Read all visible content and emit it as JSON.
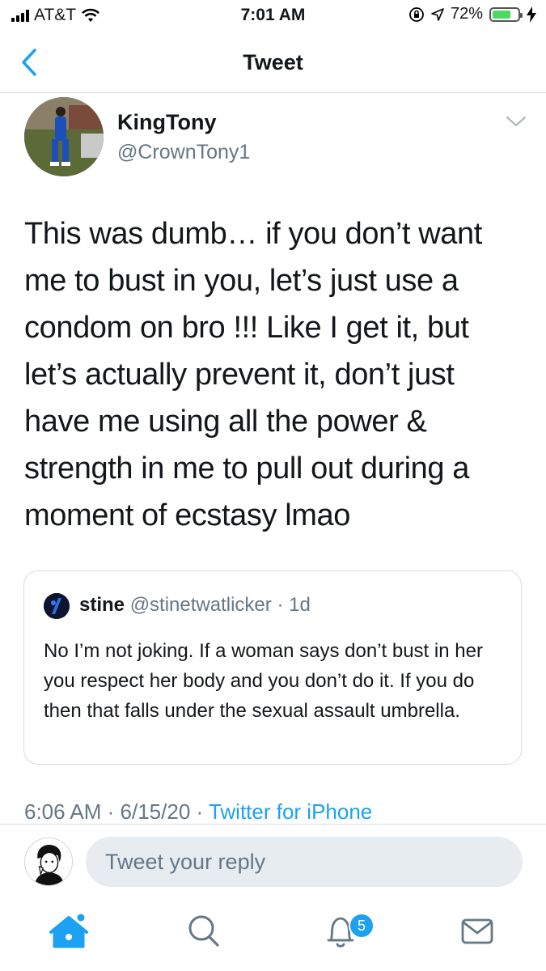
{
  "status_bar": {
    "carrier": "AT&T",
    "time": "7:01 AM",
    "battery": "72%",
    "battery_level": 0.72
  },
  "nav": {
    "title": "Tweet"
  },
  "tweet": {
    "author_name": "KingTony",
    "author_handle": "@CrownTony1",
    "text": "This was dumb… if you don’t want me to bust in you, let’s just use a condom on bro !!! Like I get it, but let’s actually prevent it, don’t just have me using all the power & strength in me to pull out during a moment of ecstasy lmao",
    "timestamp_time": "6:06 AM",
    "timestamp_date": "6/15/20",
    "source": "Twitter for iPhone"
  },
  "quoted_tweet": {
    "author_name": "stine",
    "author_handle": "@stinetwatlicker",
    "age": "1d",
    "text": "No I’m not joking. If a woman says don’t bust in her you respect her body and you don’t do it. If you do then that falls under the sexual assault umbrella."
  },
  "reply": {
    "placeholder": "Tweet your reply"
  },
  "tab_bar": {
    "notification_count": "5",
    "active_tab": "home",
    "accent_color": "#1da1f2"
  },
  "colors": {
    "primary_text": "#14171a",
    "secondary_text": "#657786",
    "accent": "#1da1f2"
  }
}
